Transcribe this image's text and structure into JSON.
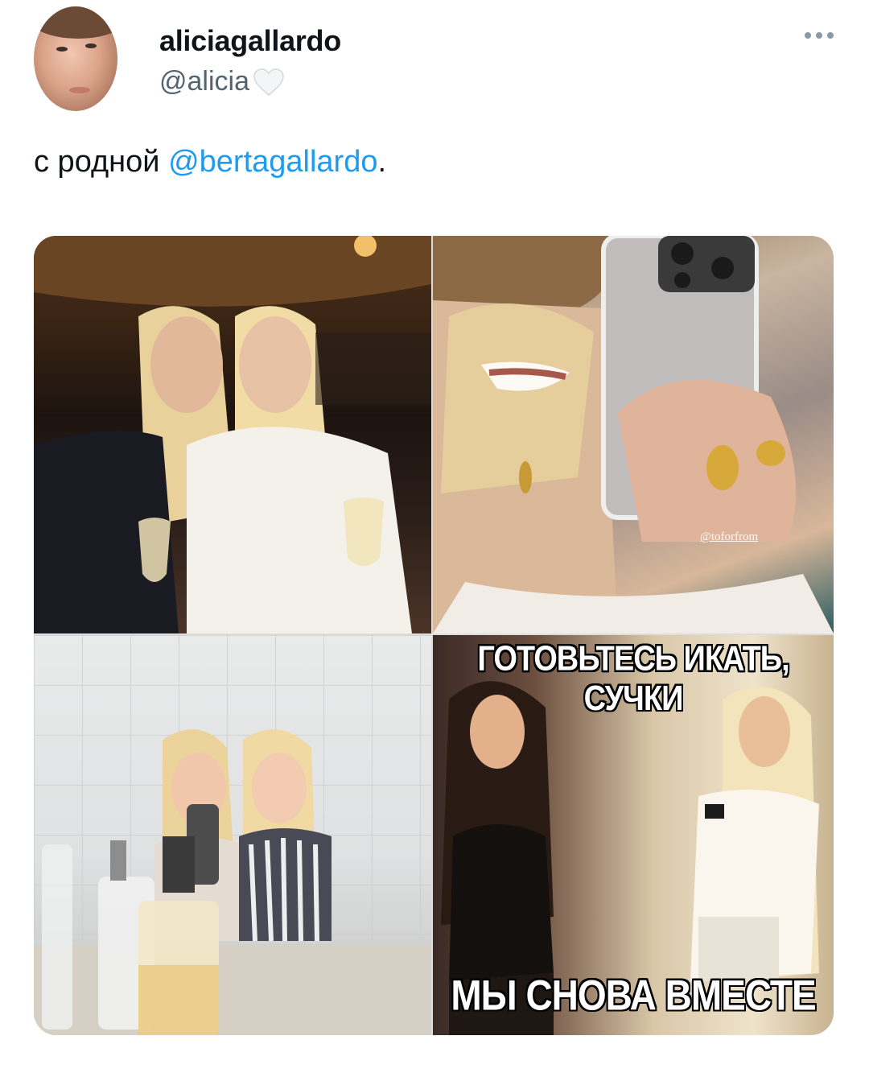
{
  "user": {
    "display_name": "aliciagallardo",
    "handle": "@alicia",
    "handle_emoji": "white-heart-icon"
  },
  "tweet": {
    "text_prefix": "с родной ",
    "mention": "@bertagallardo",
    "text_suffix": "."
  },
  "media": {
    "photo_2_watermark": "@toforfrom",
    "photo_4_top_caption": "ГОТОВЬТЕСЬ ИКАТЬ, СУЧКИ",
    "photo_4_bottom_caption": "МЫ СНОВА ВМЕСТЕ"
  }
}
